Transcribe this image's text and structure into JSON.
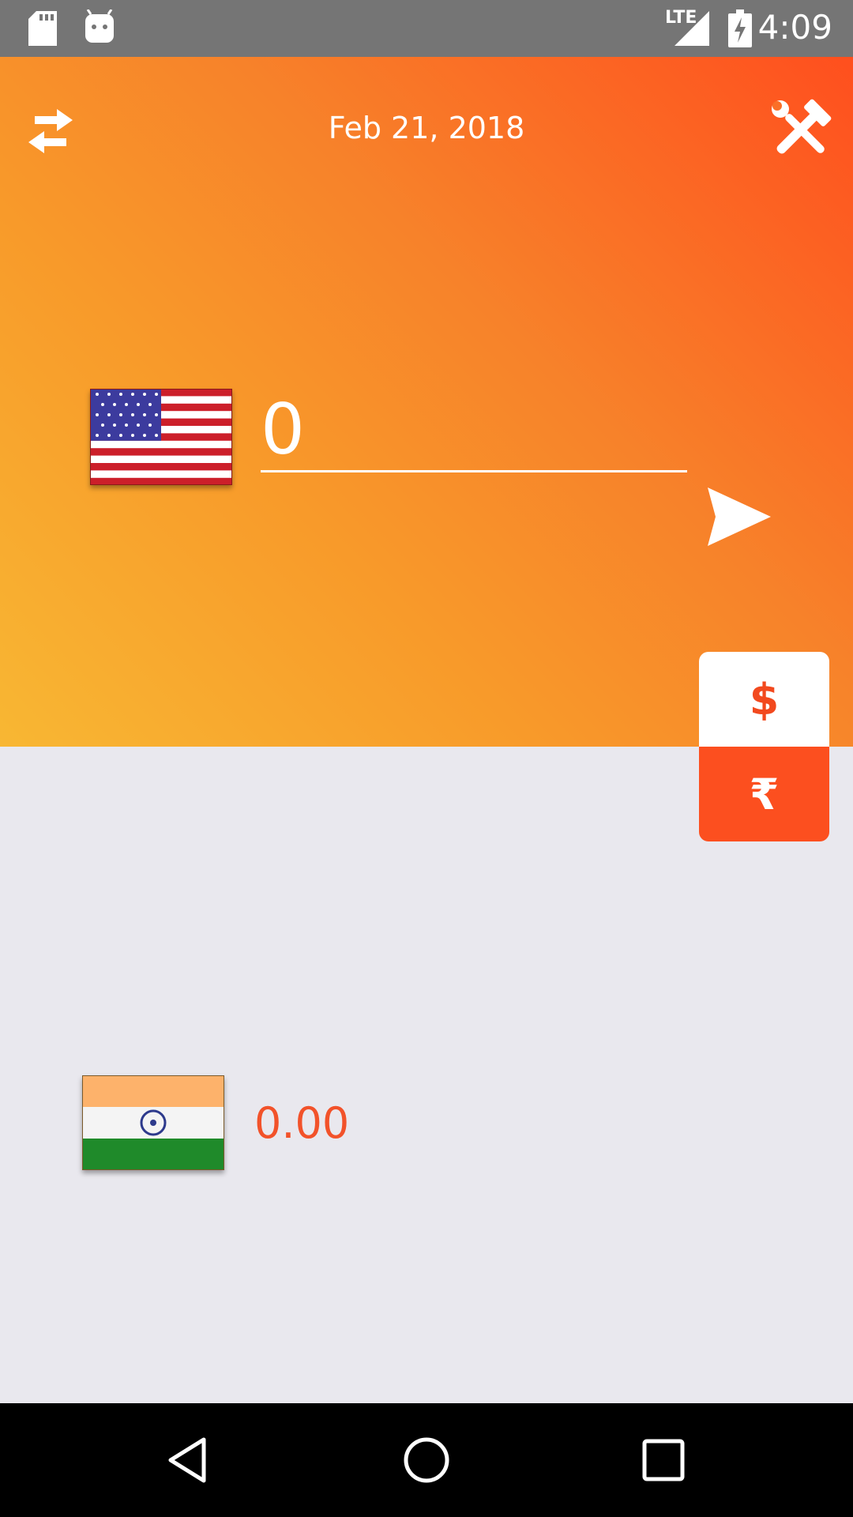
{
  "status_bar": {
    "time": "4:09",
    "network": "LTE",
    "icons": [
      "sd-card-icon",
      "android-icon",
      "signal-icon",
      "battery-charging-icon"
    ]
  },
  "header": {
    "date": "Feb 21, 2018",
    "swap_icon": "swap-arrows-icon",
    "settings_icon": "tools-icon"
  },
  "converter": {
    "from_currency": "USD",
    "amount": "0",
    "to_currency": "INR",
    "result": "0.00"
  },
  "currency_toggle": {
    "top_symbol": "$",
    "bottom_symbol": "₹",
    "selected": "₹"
  },
  "colors": {
    "gradient_start": "#f8b733",
    "gradient_end": "#ff4f1e",
    "accent": "#fc4f1f",
    "background": "#e9e8ee"
  },
  "nav_bar": {
    "icons": [
      "back-icon",
      "home-icon",
      "recents-icon"
    ]
  }
}
